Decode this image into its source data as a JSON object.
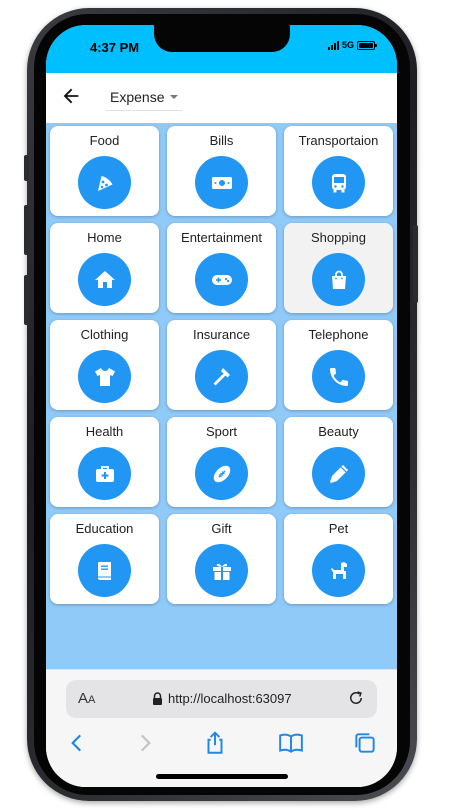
{
  "status_bar": {
    "time": "4:37 PM",
    "network": "5G"
  },
  "app_bar": {
    "transaction_type": "Expense"
  },
  "categories": [
    {
      "label": "Food",
      "icon": "pizza-icon"
    },
    {
      "label": "Bills",
      "icon": "money-icon"
    },
    {
      "label": "Transportaion",
      "icon": "bus-icon"
    },
    {
      "label": "Home",
      "icon": "home-icon"
    },
    {
      "label": "Entertainment",
      "icon": "gamepad-icon"
    },
    {
      "label": "Shopping",
      "icon": "shopping-bag-icon",
      "selected": true
    },
    {
      "label": "Clothing",
      "icon": "shirt-icon"
    },
    {
      "label": "Insurance",
      "icon": "hammer-icon"
    },
    {
      "label": "Telephone",
      "icon": "phone-icon"
    },
    {
      "label": "Health",
      "icon": "medical-kit-icon"
    },
    {
      "label": "Sport",
      "icon": "football-icon"
    },
    {
      "label": "Beauty",
      "icon": "pen-icon"
    },
    {
      "label": "Education",
      "icon": "book-icon"
    },
    {
      "label": "Gift",
      "icon": "gift-icon"
    },
    {
      "label": "Pet",
      "icon": "dog-icon"
    }
  ],
  "browser": {
    "aa_label_big": "A",
    "aa_label_small": "A",
    "url": "http://localhost:63097"
  },
  "colors": {
    "status_bar": "#00bfff",
    "grid_background": "#90caf9",
    "icon_circle": "#2196f3",
    "browser_accent": "#1e88e5"
  }
}
